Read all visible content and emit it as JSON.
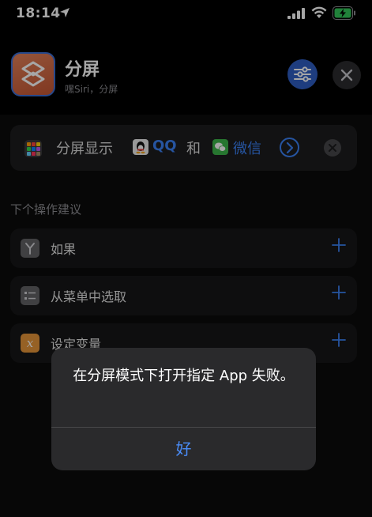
{
  "status_bar": {
    "time": "18:14"
  },
  "header": {
    "title": "分屏",
    "subtitle": "嘿Siri，分屏"
  },
  "action": {
    "text": "分屏显示",
    "app1": "QQ",
    "conjunction": "和",
    "app2": "微信"
  },
  "suggestions": {
    "heading": "下个操作建议",
    "items": [
      {
        "label": "如果",
        "icon": "if-branch-icon"
      },
      {
        "label": "从菜单中选取",
        "icon": "menu-list-icon"
      },
      {
        "label": "设定变量",
        "icon": "variable-x-icon"
      }
    ]
  },
  "alert": {
    "message": "在分屏模式下打开指定 App 失败。",
    "button": "好"
  },
  "colors": {
    "accent": "#3b82f6",
    "app_icon": "#d8643f",
    "settings_button": "#2f5fc4"
  }
}
